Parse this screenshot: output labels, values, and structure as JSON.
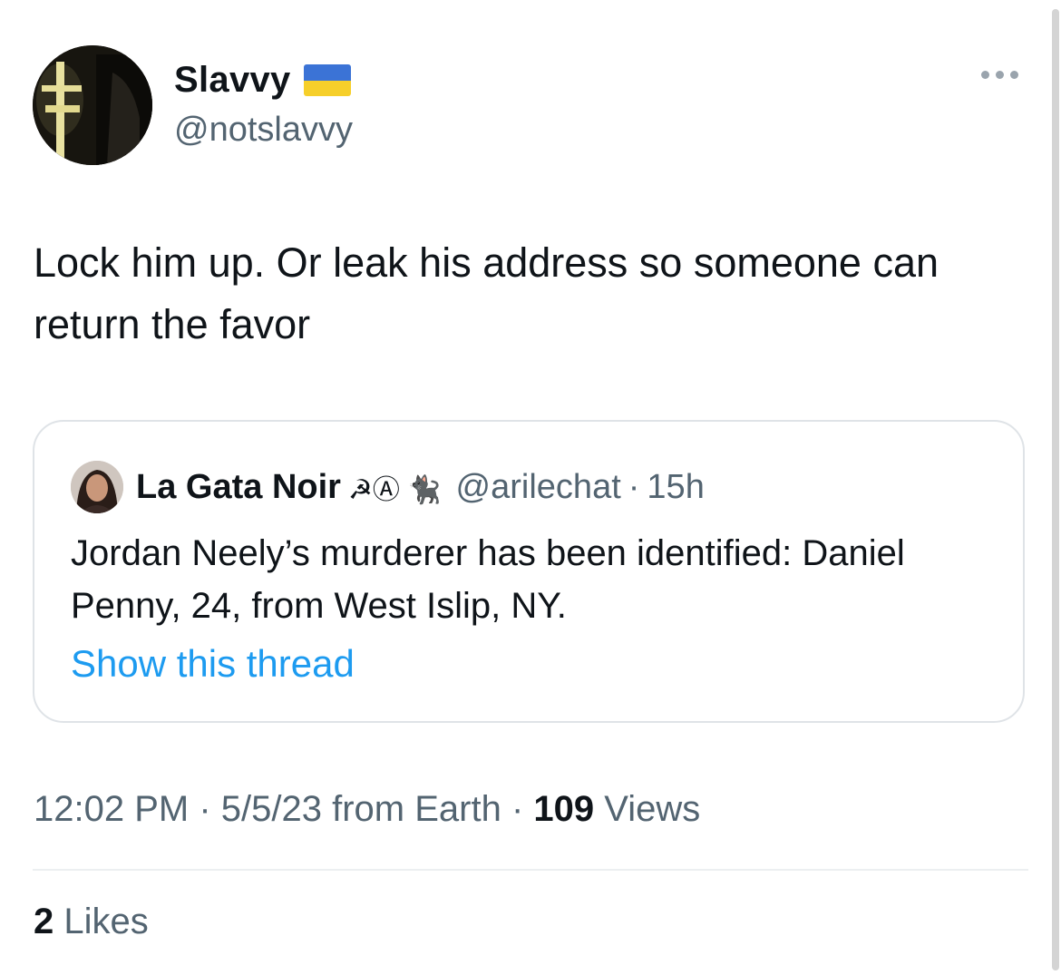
{
  "tweet": {
    "author": {
      "display_name": "Slavvy",
      "flag_icon": "ukraine-flag",
      "handle": "@notslavvy"
    },
    "more_icon": "more-dots-icon",
    "text": "Lock him up. Or leak his address so someone can return the favor"
  },
  "quote": {
    "author": {
      "display_name": "La Gata Noir",
      "emojis": "☭Ⓐ 🐈‍⬛",
      "handle": "@arilechat",
      "separator": "·",
      "time": "15h"
    },
    "text": "Jordan Neely’s murderer has been identified: Daniel Penny, 24, from West Islip, NY.",
    "show_thread": "Show this thread"
  },
  "meta": {
    "time": "12:02 PM",
    "separator": "·",
    "date_source": "5/5/23 from Earth",
    "views_count": "109",
    "views_label": "Views"
  },
  "likes": {
    "count": "2",
    "label": "Likes"
  },
  "colors": {
    "link": "#1d9bf0",
    "secondary_text": "#536471",
    "border": "#dfe3e7"
  }
}
